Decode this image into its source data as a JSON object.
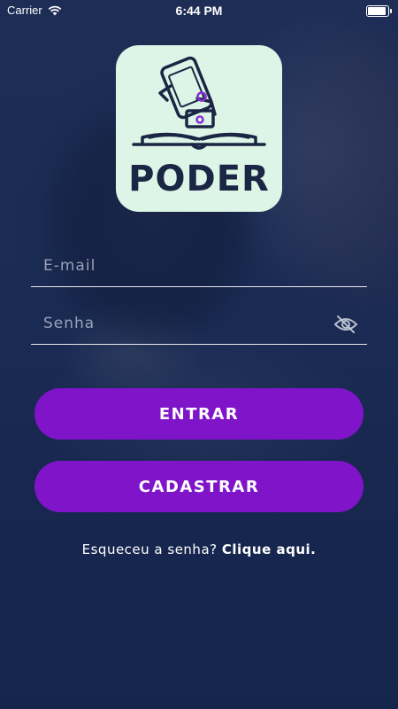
{
  "status_bar": {
    "carrier": "Carrier",
    "time": "6:44 PM"
  },
  "logo": {
    "text": "PODER"
  },
  "form": {
    "email_placeholder": "E-mail",
    "password_placeholder": "Senha"
  },
  "buttons": {
    "login_label": "ENTRAR",
    "signup_label": "CADASTRAR"
  },
  "forgot": {
    "prefix": "Esqueceu a senha?",
    "link": "Clique aqui."
  },
  "colors": {
    "accent": "#7f14c9",
    "logo_bg": "#dcf5e6",
    "logo_text": "#1b2644"
  }
}
